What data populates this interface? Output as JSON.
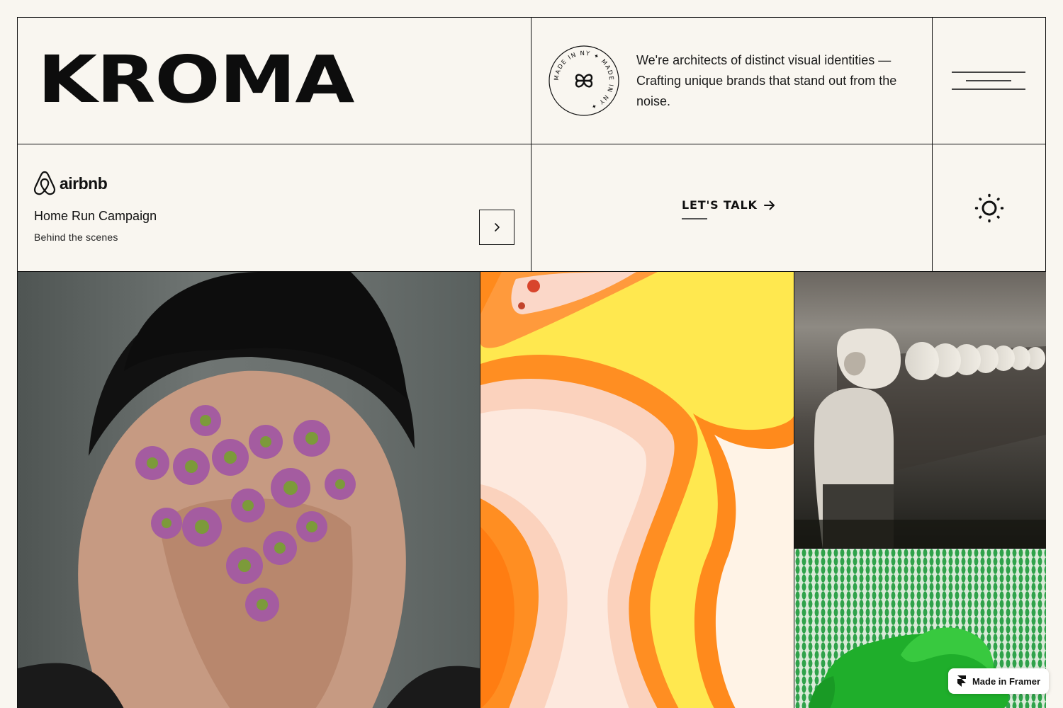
{
  "brand": {
    "wordmark": "KROMA"
  },
  "about": {
    "badge_text": "MADE IN NY ✦ MADE IN NY ✦",
    "tagline": "We're architects of distinct visual identities — Crafting unique brands that stand out from the noise."
  },
  "featured_case": {
    "client": "airbnb",
    "title": "Home Run Campaign",
    "subtitle": "Behind the scenes"
  },
  "cta": {
    "label": "LET'S TALK"
  },
  "gallery": {
    "images": [
      {
        "name": "flowers-face"
      },
      {
        "name": "fluid-marble"
      },
      {
        "name": "astronaut-corridor"
      },
      {
        "name": "green-figure"
      }
    ]
  },
  "framer_badge": {
    "label": "Made in Framer"
  },
  "colors": {
    "background": "#f9f6f0",
    "ink": "#111111",
    "accent_yellow": "#ffe04a",
    "accent_orange": "#ff8a1c"
  },
  "icons": [
    "menu-icon",
    "chevron-right-icon",
    "arrow-right-icon",
    "sun-icon",
    "airbnb-logo-icon",
    "framer-icon"
  ]
}
